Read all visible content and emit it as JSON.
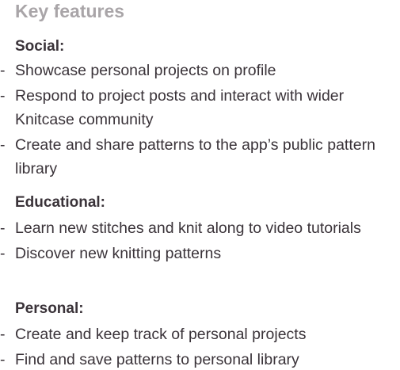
{
  "heading": "Key features",
  "bullet_glyph": "-",
  "sections": [
    {
      "title": "Social:",
      "items": [
        "Showcase personal projects on profile",
        "Respond to project posts and interact with wider Knitcase community",
        "Create and share patterns to the app’s public pattern library"
      ]
    },
    {
      "title": "Educational:",
      "items": [
        "Learn new stitches and knit along to video tutorials",
        "Discover new knitting patterns"
      ]
    },
    {
      "title": "Personal:",
      "items": [
        "Create and keep track of personal projects",
        "Find and save patterns to personal library"
      ]
    }
  ],
  "colors": {
    "heading": "#a9a5a8",
    "text": "#3a3339"
  }
}
